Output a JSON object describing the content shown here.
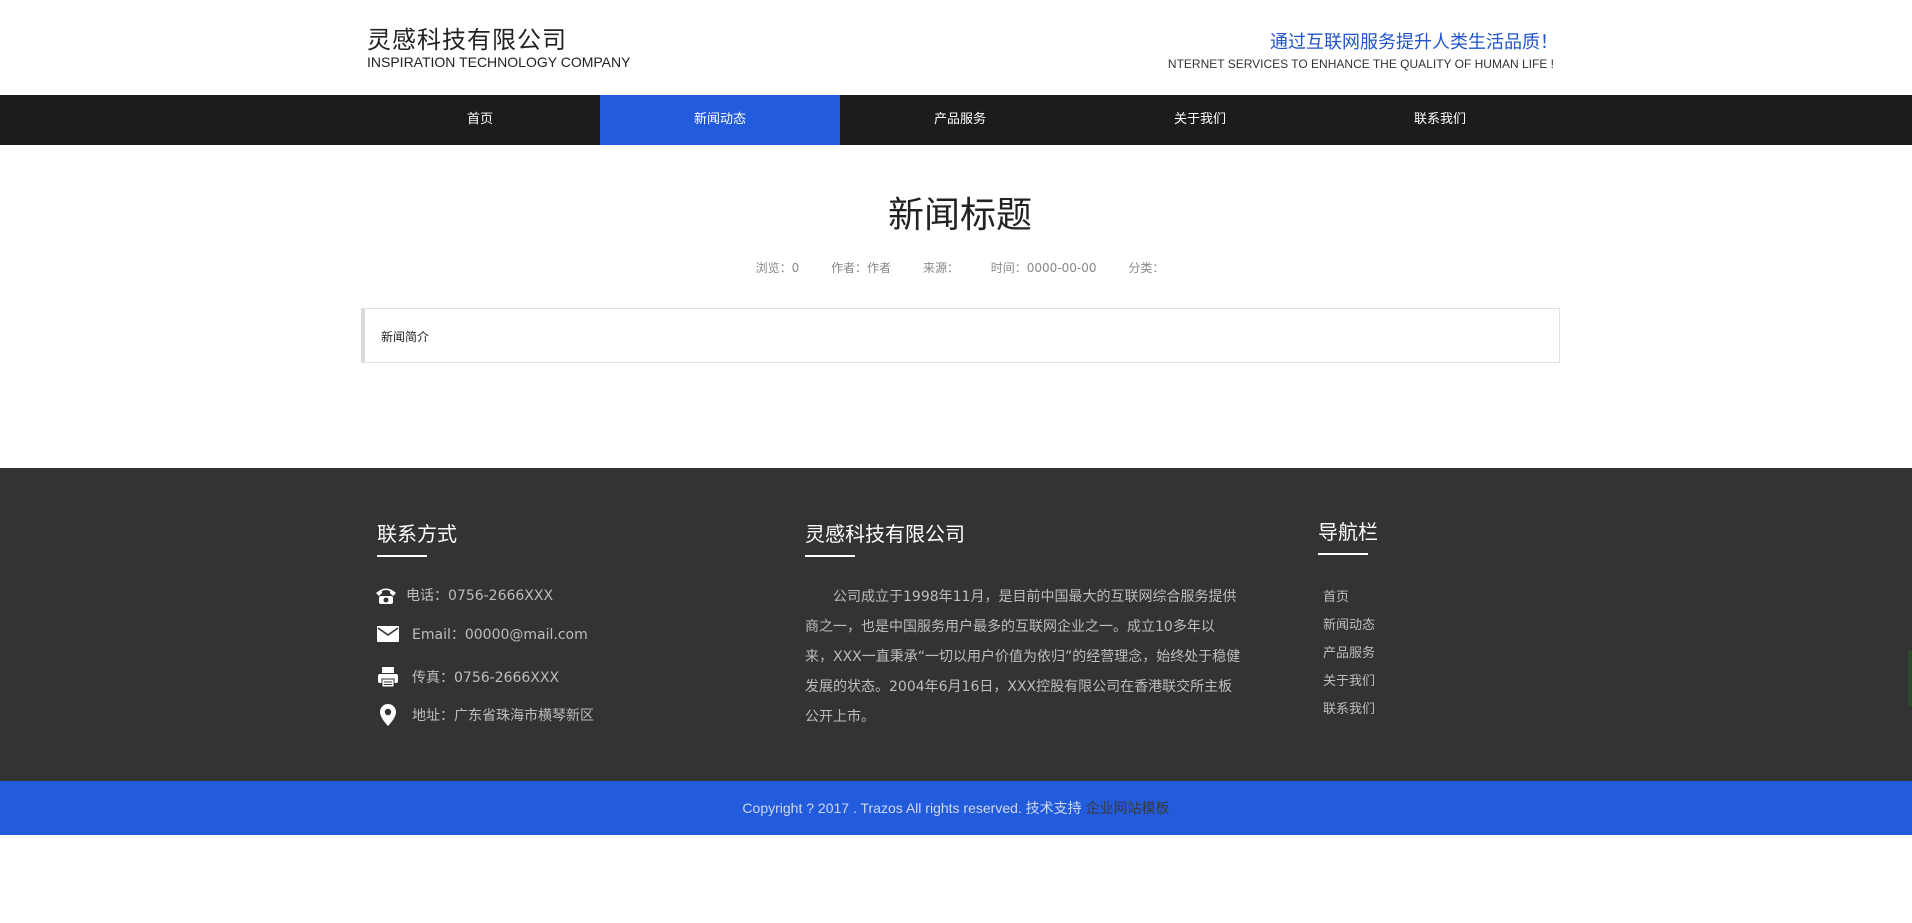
{
  "header": {
    "company_cn": "灵感科技有限公司",
    "company_en": "INSPIRATION TECHNOLOGY COMPANY",
    "slogan_cn": "通过互联网服务提升人类生活品质！",
    "slogan_en": "NTERNET SERVICES TO ENHANCE THE QUALITY OF HUMAN LIFE !"
  },
  "nav": {
    "items": [
      {
        "label": "首页"
      },
      {
        "label": "新闻动态"
      },
      {
        "label": "产品服务"
      },
      {
        "label": "关于我们"
      },
      {
        "label": "联系我们"
      }
    ],
    "active_index": 1
  },
  "article": {
    "title": "新闻标题",
    "meta": {
      "views": "浏览：0",
      "author": "作者：作者",
      "source": "来源：",
      "time": "时间：0000-00-00",
      "category": "分类："
    },
    "summary": "新闻简介"
  },
  "footer": {
    "contact": {
      "title": "联系方式",
      "phone": "电话：0756-2666XXX",
      "email": "Email：00000@mail.com",
      "fax": "传真：0756-2666XXX",
      "address": "地址：广东省珠海市横琴新区"
    },
    "company": {
      "title": "灵感科技有限公司",
      "about": "公司成立于1998年11月，是目前中国最大的互联网综合服务提供商之一，也是中国服务用户最多的互联网企业之一。成立10多年以来，XXX一直秉承“一切以用户价值为依归”的经营理念，始终处于稳健发展的状态。2004年6月16日，XXX控股有限公司在香港联交所主板公开上市。"
    },
    "navigation": {
      "title": "导航栏",
      "items": [
        "首页",
        "新闻动态",
        "产品服务",
        "关于我们",
        "联系我们"
      ]
    }
  },
  "copyright": {
    "text": "Copyright ? 2017 . Trazos All rights reserved. 技术支持 ",
    "link": "企业网站模板"
  },
  "colors": {
    "accent": "#225bdb",
    "nav_bg": "#1c1c1c",
    "footer_bg": "#333333"
  }
}
